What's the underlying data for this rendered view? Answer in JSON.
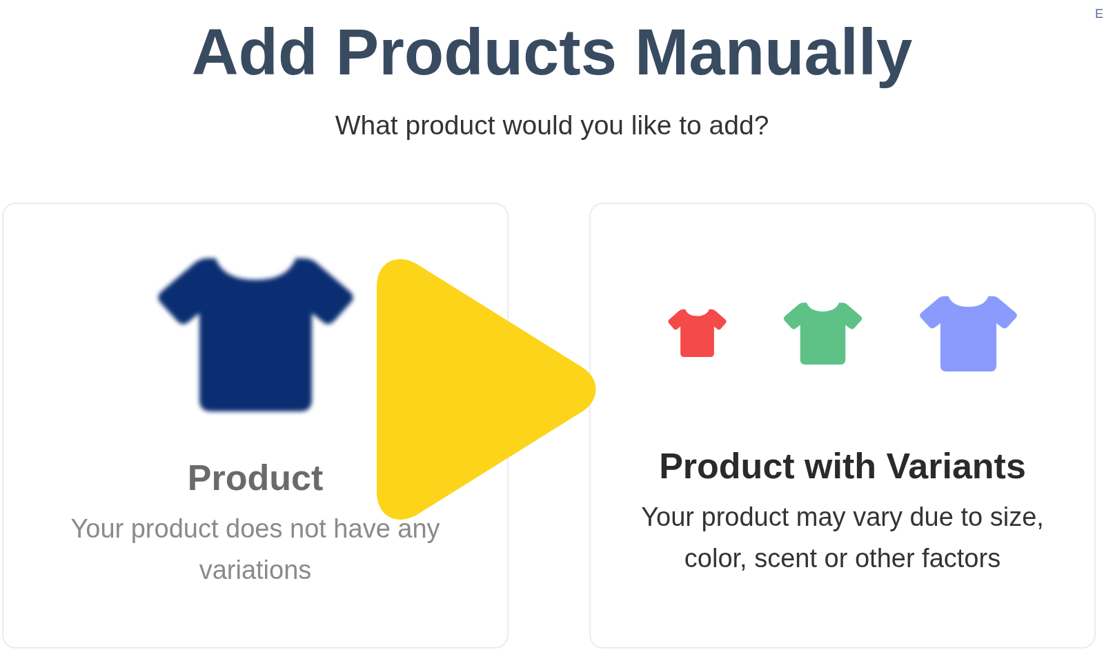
{
  "page": {
    "title": "Add Products Manually",
    "subtitle": "What product would you like to add?",
    "corner_text": "E"
  },
  "options": [
    {
      "kind": "single",
      "title": "Product",
      "description": "Your product does not have any variations",
      "blurred": true
    },
    {
      "kind": "variants",
      "title": "Product with Variants",
      "description": "Your product may vary due to size, color, scent or other factors",
      "blurred": false,
      "shirts": [
        {
          "color": "#f54a4a"
        },
        {
          "color": "#5ec287"
        },
        {
          "color": "#8a9bfd"
        }
      ]
    }
  ],
  "play_overlay": true
}
